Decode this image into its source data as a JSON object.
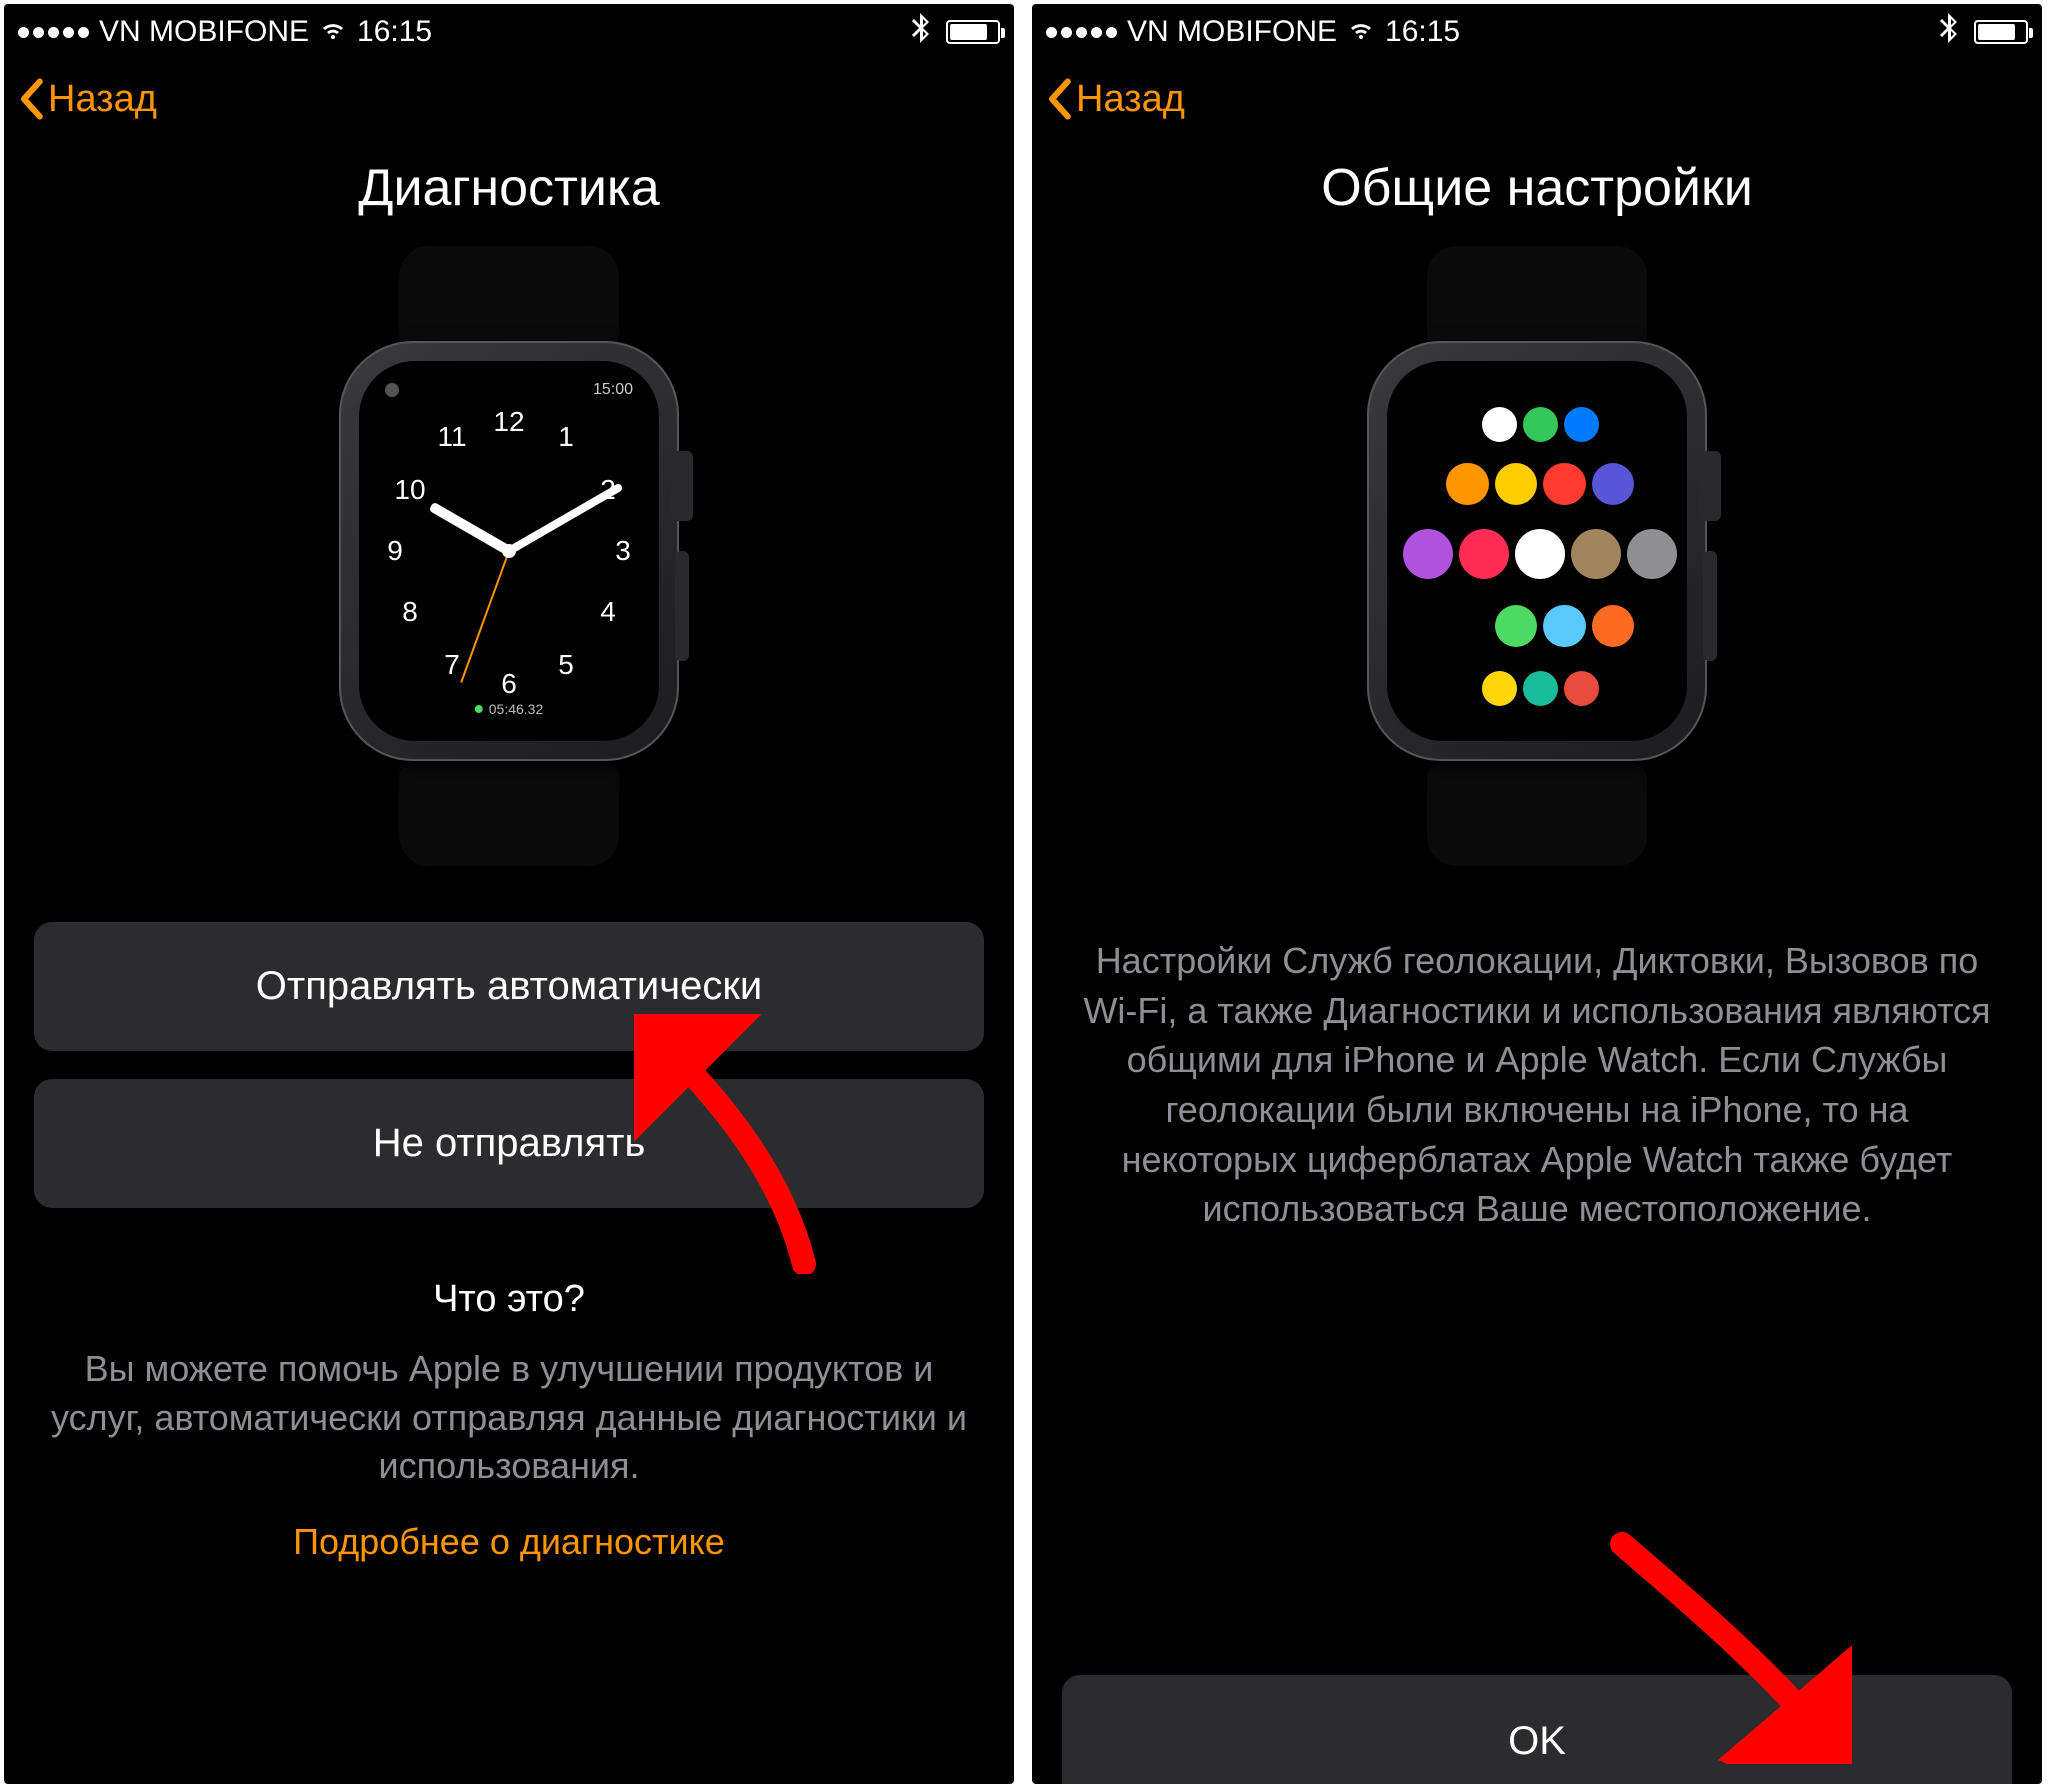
{
  "status": {
    "carrier": "VN MOBIFONE",
    "time": "16:15"
  },
  "nav": {
    "back_label": "Назад"
  },
  "left": {
    "title": "Диагностика",
    "watch_face": {
      "time": "15:00",
      "bottom_text": "05:46.32"
    },
    "buttons": {
      "send_auto": "Отправлять автоматически",
      "dont_send": "Не отправлять"
    },
    "info_title": "Что это?",
    "info_text": "Вы можете помочь Apple в улучшении продуктов и услуг, автоматически отправляя данные диагностики и использования.",
    "info_link": "Подробнее о диагностике"
  },
  "right": {
    "title": "Общие настройки",
    "body_text": "Настройки Служб геолокации, Диктовки, Вызовов по Wi-Fi, а также Диагностики и использования являются общими для iPhone и Apple Watch. Если Службы геолокации были включены на iPhone, то на некоторых циферблатах Apple Watch также будет использоваться Ваше местоположение.",
    "ok_label": "OK"
  },
  "colors": {
    "accent": "#ff9500",
    "button_bg": "#2c2c2e",
    "secondary_text": "#8e8e93",
    "arrow": "#ff0000"
  }
}
